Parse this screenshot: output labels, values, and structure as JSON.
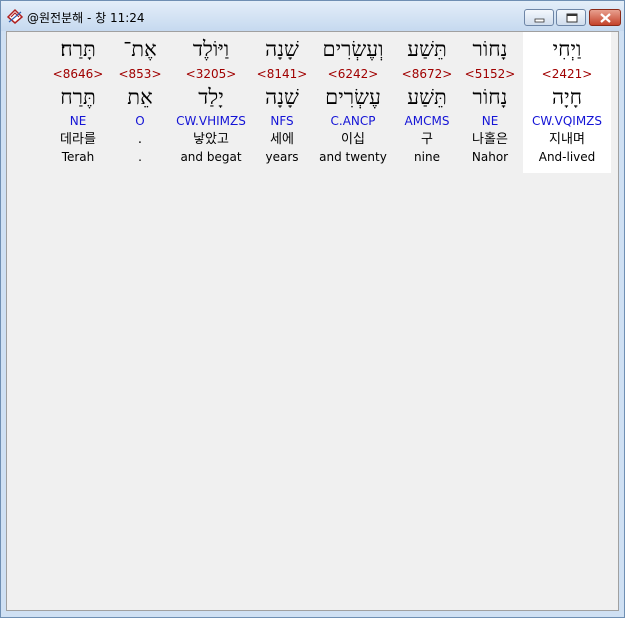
{
  "window": {
    "title": "@원전분해 - 창 11:24",
    "icon": "app-icon",
    "buttons": {
      "minimize": "minimize-icon",
      "maximize": "maximize-icon",
      "close": "close-icon"
    }
  },
  "columns": [
    {
      "hebrew": "וַיְחִי",
      "strong": "<2421>",
      "lemma": "חָיָה",
      "parse": "CW.VQIMZS",
      "korean": "지내며",
      "english": "And-lived"
    },
    {
      "hebrew": "נָחוֹר",
      "strong": "<5152>",
      "lemma": "נָחוֹר",
      "parse": "NE",
      "korean": "나홀은",
      "english": "Nahor"
    },
    {
      "hebrew": "תֵּשַׁע",
      "strong": "<8672>",
      "lemma": "תֵּשַׁע",
      "parse": "AMCMS",
      "korean": "구",
      "english": "nine"
    },
    {
      "hebrew": "וְעֶשְׂרִים",
      "strong": "<6242>",
      "lemma": "עֶשְׂרִים",
      "parse": "C.ANCP",
      "korean": "이십",
      "english": "and twenty"
    },
    {
      "hebrew": "שָׁנָה",
      "strong": "<8141>",
      "lemma": "שָׁנָה",
      "parse": "NFS",
      "korean": "세에",
      "english": "years"
    },
    {
      "hebrew": "וַיּוֹלֶד",
      "strong": "<3205>",
      "lemma": "יָלַד",
      "parse": "CW.VHIMZS",
      "korean": "낳았고",
      "english": "and begat"
    },
    {
      "hebrew": "אֶת־",
      "strong": "<853>",
      "lemma": "אֵת",
      "parse": "O",
      "korean": ".",
      "english": "."
    },
    {
      "hebrew": "תָּרַח׃",
      "strong": "<8646>",
      "lemma": "תֶּרַח",
      "parse": "NE",
      "korean": "데라를",
      "english": "Terah"
    }
  ]
}
